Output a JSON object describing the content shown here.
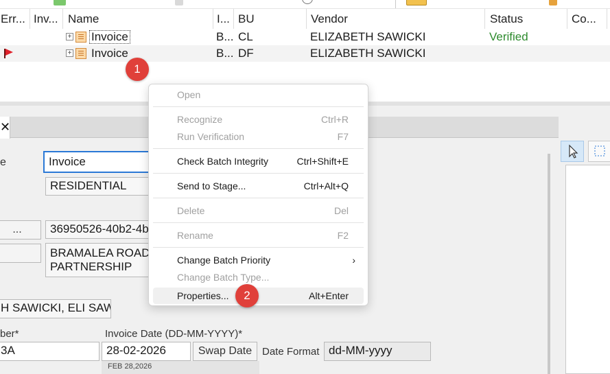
{
  "colors": {
    "accent": "#2a78d6",
    "verified": "#2e8b2e",
    "flag": "#e0202a",
    "badge": "#e0403a",
    "menu_disabled": "#a0a0a0"
  },
  "grid": {
    "columns": [
      "Err...",
      "Inv...",
      "Name",
      "I...",
      "BU",
      "Vendor",
      "Status",
      "Co..."
    ],
    "rows": [
      {
        "name": "Invoice",
        "i": "B...",
        "bu": "CL",
        "vendor": "ELIZABETH SAWICKI",
        "status": "Verified",
        "flag": false
      },
      {
        "name": "Invoice",
        "i": "B...",
        "bu": "DF",
        "vendor": "ELIZABETH SAWICKI",
        "status": "",
        "flag": true
      }
    ]
  },
  "context_menu": {
    "items": [
      {
        "label": "Open",
        "shortcut": "",
        "disabled": true
      },
      {
        "label": "Recognize",
        "shortcut": "Ctrl+R",
        "disabled": true
      },
      {
        "label": "Run Verification",
        "shortcut": "F7",
        "disabled": true
      },
      {
        "label": "Check Batch Integrity",
        "shortcut": "Ctrl+Shift+E",
        "disabled": false
      },
      {
        "label": "Send to Stage...",
        "shortcut": "Ctrl+Alt+Q",
        "disabled": false
      },
      {
        "label": "Delete",
        "shortcut": "Del",
        "disabled": true
      },
      {
        "label": "Rename",
        "shortcut": "F2",
        "disabled": true
      },
      {
        "label": "Change Batch Priority",
        "shortcut": "",
        "disabled": false,
        "submenu": true
      },
      {
        "label": "Change Batch Type...",
        "shortcut": "",
        "disabled": true
      },
      {
        "label": "Properties...",
        "shortcut": "Alt+Enter",
        "disabled": false
      }
    ]
  },
  "badges": {
    "step1": "1",
    "step2": "2"
  },
  "form": {
    "type_label_partial": "e",
    "doc_type_value": "Invoice",
    "class_value": "RESIDENTIAL",
    "small_btn_label": "...",
    "guid_value": "36950526-40b2-4b",
    "vendor_name_line1": "BRAMALEA ROAD",
    "vendor_name_line2": "PARTNERSHIP",
    "vendor_contact_value": "H SAWICKI, ELI SAW",
    "invoice_number_label_partial": "ber*",
    "invoice_number_value": "3A",
    "invoice_date_label": "Invoice Date (DD-MM-YYYY)*",
    "invoice_date_value": "28-02-2026",
    "swap_date_label": "Swap Date",
    "date_format_label": "Date Format",
    "date_format_value": "dd-MM-yyyy",
    "date_hint": "FEB 28,2026"
  }
}
